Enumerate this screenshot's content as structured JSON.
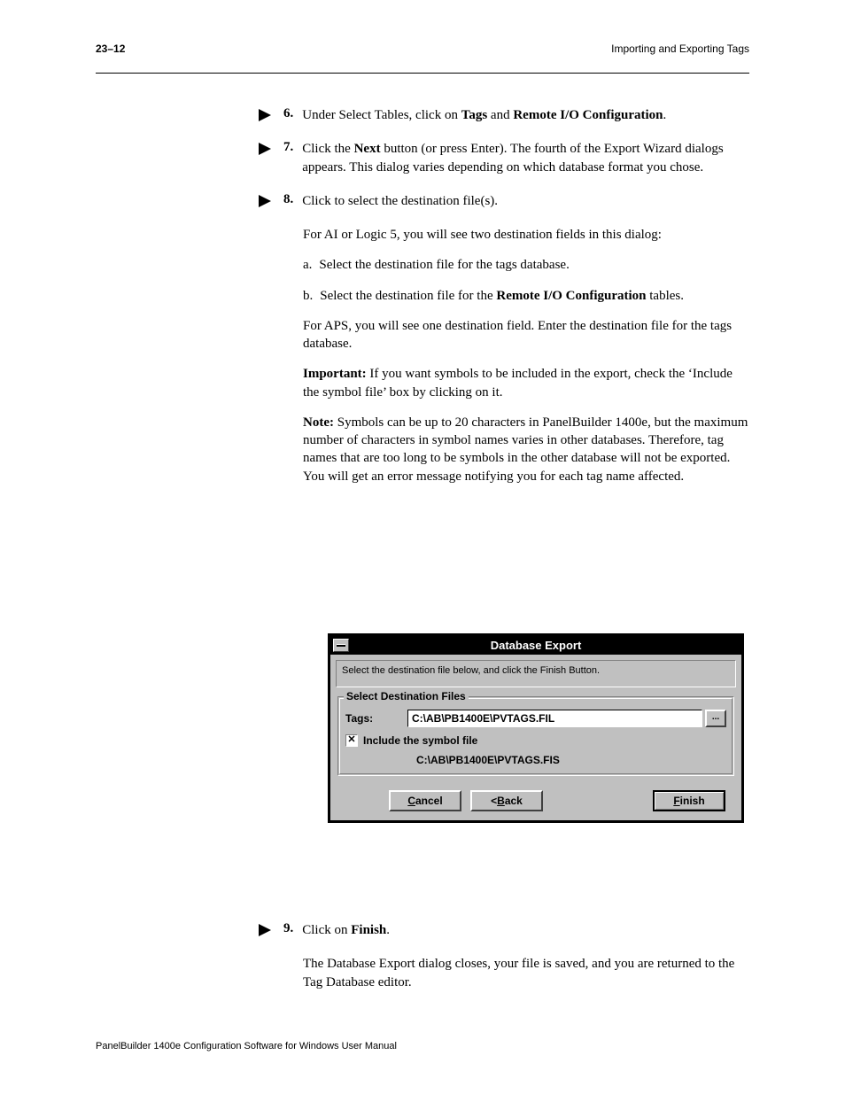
{
  "header": {
    "page_num": "23–12",
    "chapter": "Importing and Exporting Tags"
  },
  "steps": {
    "s6": {
      "num": "6.",
      "text_a": "Under Select Tables, click on ",
      "bold1": "Tags",
      "text_b": " and ",
      "bold2": "Remote I/O Configuration",
      "text_c": "."
    },
    "s7": {
      "num": "7.",
      "text_a": "Click the ",
      "bold1": "Next",
      "text_b": " button (or press Enter). The fourth of the Export Wizard dialogs appears. This dialog varies depending on which database format you chose."
    },
    "s8": {
      "num": "8.",
      "text": "Click to select the destination file(s).",
      "block": "For AI or Logic 5, you will see two destination fields in this dialog:",
      "sub_a": {
        "label": "a.",
        "text": "Select the destination file for the tags database."
      },
      "sub_b": {
        "label": "b.",
        "text_a": "Select the destination file for the ",
        "bold": "Remote I/O Configuration",
        "text_b": " tables."
      },
      "block2": "For APS, you will see one destination field. Enter the destination file for the tags database.",
      "important": {
        "label": "Important:",
        "text": "If you want symbols to be included in the export, check the ‘Include the symbol file’ box by clicking on it."
      },
      "note": {
        "label": "Note:",
        "text": "Symbols can be up to 20 characters in PanelBuilder 1400e, but the maximum number of characters in symbol names varies in other databases. Therefore, tag names that are too long to be symbols in the other database will not be exported. You will get an error message notifying you for each tag name affected."
      }
    },
    "s9": {
      "num": "9.",
      "text_a": "Click on ",
      "bold": "Finish",
      "text_b": "."
    },
    "after": "The Database Export dialog closes, your file is saved, and you are returned to the Tag Database editor."
  },
  "dialog": {
    "title": "Database Export",
    "instruction": "Select the destination file below, and click the Finish  Button.",
    "group_label": "Select Destination Files",
    "tags_label": "Tags:",
    "tags_value": "C:\\AB\\PB1400E\\PVTAGS.FIL",
    "browse_label": "...",
    "checkbox_checked": "✕",
    "checkbox_label": "Include the symbol file",
    "symbol_path": "C:\\AB\\PB1400E\\PVTAGS.FIS",
    "btn_cancel": "Cancel",
    "btn_back": "<Back",
    "btn_finish": "Finish"
  },
  "footer": "PanelBuilder 1400e Configuration Software for Windows User Manual"
}
